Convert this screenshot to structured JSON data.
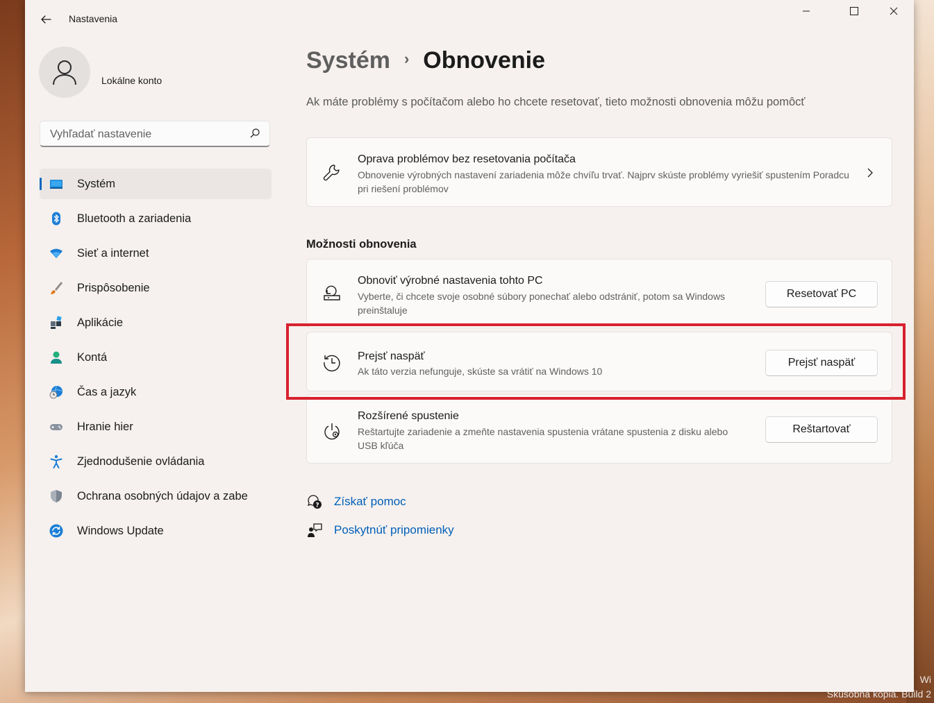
{
  "window": {
    "title": "Nastavenia"
  },
  "account": {
    "name": "Lokálne konto"
  },
  "search": {
    "placeholder": "Vyhľadať nastavenie"
  },
  "sidebar": {
    "items": [
      {
        "label": "Systém",
        "icon": "system-icon",
        "selected": true
      },
      {
        "label": "Bluetooth a zariadenia",
        "icon": "bluetooth-icon"
      },
      {
        "label": "Sieť a internet",
        "icon": "wifi-icon"
      },
      {
        "label": "Prispôsobenie",
        "icon": "brush-icon"
      },
      {
        "label": "Aplikácie",
        "icon": "apps-icon"
      },
      {
        "label": "Kontá",
        "icon": "person-icon"
      },
      {
        "label": "Čas a jazyk",
        "icon": "globe-clock-icon"
      },
      {
        "label": "Hranie hier",
        "icon": "gamepad-icon"
      },
      {
        "label": "Zjednodušenie ovládania",
        "icon": "accessibility-icon"
      },
      {
        "label": "Ochrana osobných údajov a zabe",
        "icon": "shield-icon"
      },
      {
        "label": "Windows Update",
        "icon": "update-icon"
      }
    ]
  },
  "breadcrumb": {
    "parent": "Systém",
    "separator": "›",
    "current": "Obnovenie"
  },
  "subtitle": "Ak máte problémy s počítačom alebo ho chcete resetovať, tieto možnosti obnovenia môžu pomôcť",
  "troubleshoot": {
    "title": "Oprava problémov bez resetovania počítača",
    "description": "Obnovenie výrobných nastavení zariadenia môže chvíľu trvať. Najprv skúste problémy vyriešiť spustením Poradcu pri riešení problémov"
  },
  "recovery": {
    "section_title": "Možnosti obnovenia",
    "options": [
      {
        "title": "Obnoviť výrobné nastavenia tohto PC",
        "description": "Vyberte, či chcete svoje osobné súbory ponechať alebo odstrániť, potom sa Windows preinštaluje",
        "button": "Resetovať PC"
      },
      {
        "title": "Prejsť naspäť",
        "description": "Ak táto verzia nefunguje, skúste sa vrátiť na Windows 10",
        "button": "Prejsť naspäť"
      },
      {
        "title": "Rozšírené spustenie",
        "description": "Reštartujte zariadenie a zmeňte nastavenia spustenia vrátane spustenia z disku alebo USB kľúča",
        "button": "Reštartovať"
      }
    ]
  },
  "links": {
    "help": "Získať pomoc",
    "feedback": "Poskytnúť pripomienky"
  },
  "watermark": {
    "line1": "Wi",
    "line2": "Skúšobná kópia. Build 2"
  },
  "colors": {
    "accent": "#0067c0",
    "link": "#005fb8",
    "highlight": "#d8212f"
  }
}
